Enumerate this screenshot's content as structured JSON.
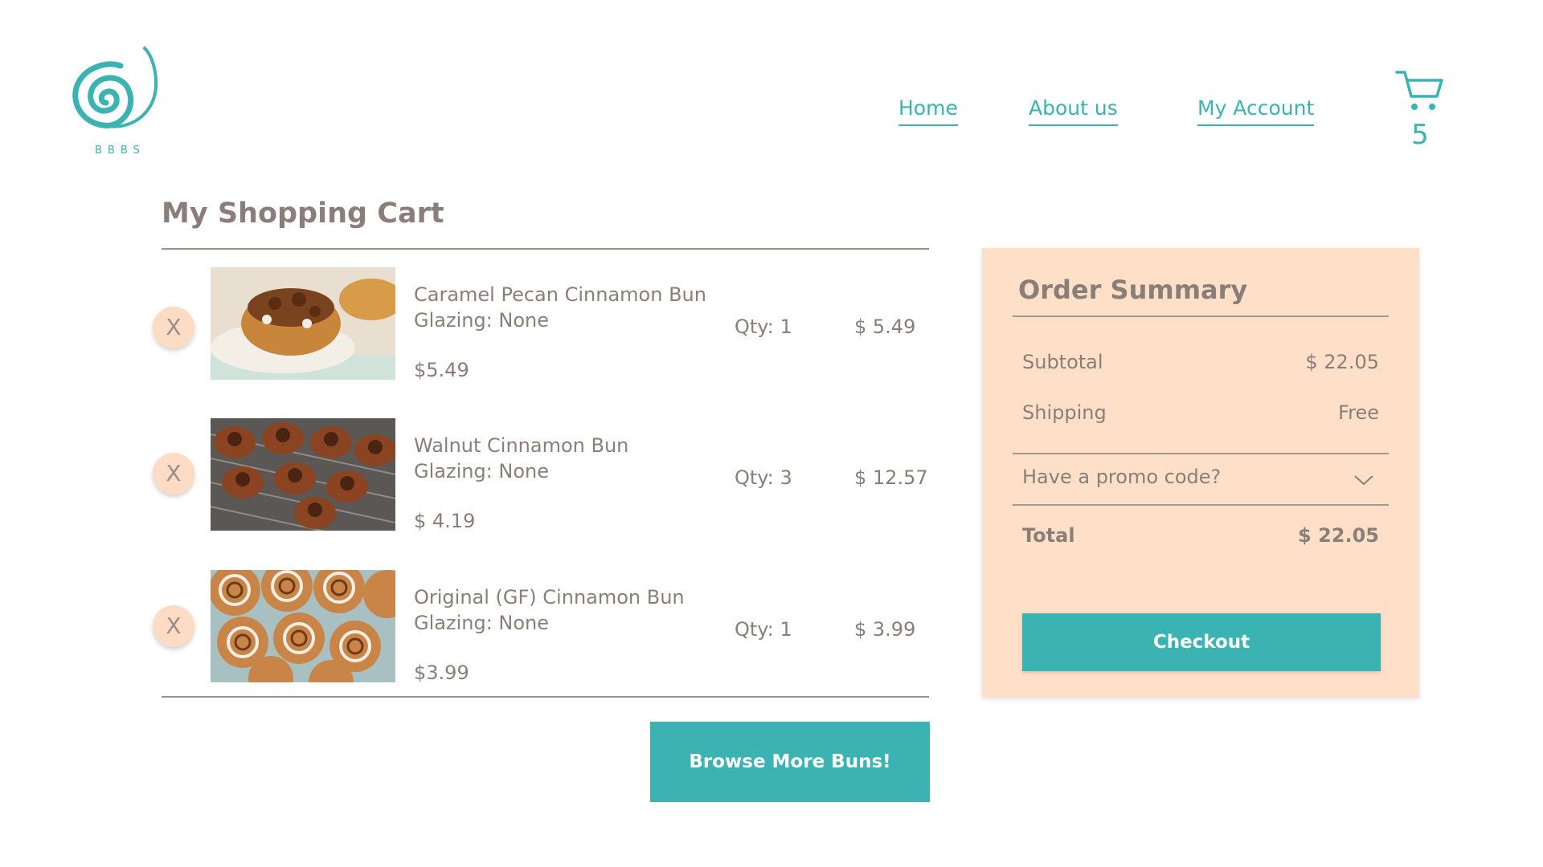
{
  "header": {
    "logo_text": "BBBS",
    "nav": {
      "home": "Home",
      "about": "About us",
      "account": "My Account"
    },
    "cart_count": "5",
    "accent_color": "#3ab3b2"
  },
  "cart": {
    "title": "My Shopping Cart",
    "remove_label": "X",
    "items": [
      {
        "name": "Caramel Pecan Cinnamon Bun",
        "glazing": "Glazing: None",
        "unit_price": "$5.49",
        "qty": "Qty: 1",
        "line_total": "$ 5.49",
        "image": "caramel-pecan-bun-photo"
      },
      {
        "name": "Walnut Cinnamon Bun",
        "glazing": "Glazing: None",
        "unit_price": "$ 4.19",
        "qty": "Qty: 3",
        "line_total": "$ 12.57",
        "image": "walnut-bun-photo"
      },
      {
        "name": "Original (GF) Cinnamon Bun",
        "glazing": "Glazing: None",
        "unit_price": "$3.99",
        "qty": "Qty: 1",
        "line_total": "$ 3.99",
        "image": "original-gf-bun-photo"
      }
    ],
    "browse_button": "Browse More Buns!"
  },
  "summary": {
    "title": "Order Summary",
    "subtotal_label": "Subtotal",
    "subtotal_value": "$ 22.05",
    "shipping_label": "Shipping",
    "shipping_value": "Free",
    "promo_label": "Have a promo code?",
    "total_label": "Total",
    "total_value": "$ 22.05",
    "checkout_button": "Checkout",
    "background_color": "#fde0c7"
  }
}
